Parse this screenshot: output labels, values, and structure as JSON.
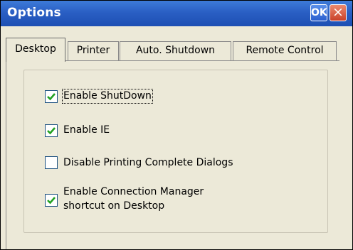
{
  "window": {
    "title": "Options",
    "ok_label": "OK",
    "close_label": "×"
  },
  "tabs": [
    {
      "label": "Desktop",
      "selected": true
    },
    {
      "label": "Printer",
      "selected": false
    },
    {
      "label": "Auto. Shutdown",
      "selected": false
    },
    {
      "label": "Remote Control",
      "selected": false
    }
  ],
  "options": [
    {
      "label": "Enable ShutDown",
      "checked": true,
      "focused": true
    },
    {
      "label": "Enable IE",
      "checked": true,
      "focused": false
    },
    {
      "label": "Disable Printing Complete Dialogs",
      "checked": false,
      "focused": false
    },
    {
      "label_line1": "Enable Connection Manager",
      "label_line2": "shortcut on Desktop",
      "checked": true,
      "focused": false
    }
  ],
  "colors": {
    "titlebar": "#2a5fc4",
    "window_bg": "#ECE9D8",
    "check_mark": "#21a121",
    "checkbox_border": "#1c5180",
    "close_button": "#c9412a"
  }
}
